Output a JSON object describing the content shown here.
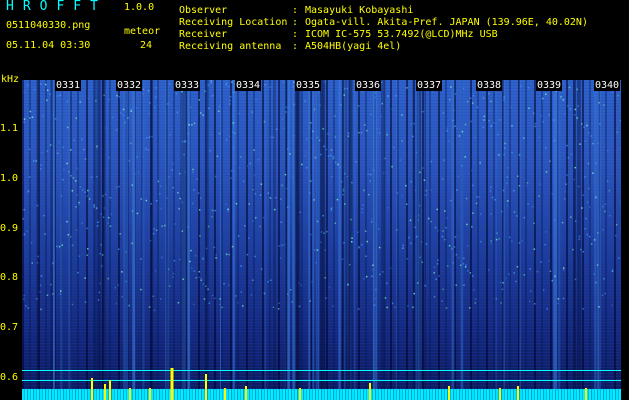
{
  "header": {
    "app_title": "HROFFT",
    "app_version": "1.0.0",
    "file_name": "0511040330.png",
    "meteor_label": "meteor",
    "datetime": "05.11.04 03:30",
    "meteor_count": "24"
  },
  "info": [
    {
      "label": "Observer",
      "value": "Masayuki Kobayashi"
    },
    {
      "label": "Receiving Location",
      "value": "Ogata-vill. Akita-Pref. JAPAN (139.96E, 40.02N)"
    },
    {
      "label": "Receiver",
      "value": "ICOM IC-575 53.7492(@LCD)MHz USB"
    },
    {
      "label": "Receiving antenna",
      "value": "A504HB(yagi 4el)"
    }
  ],
  "colon": ":",
  "y_axis": {
    "unit": "kHz",
    "ticks": [
      "1.1",
      "1.0",
      "0.9",
      "0.8",
      "0.7",
      "0.6"
    ]
  },
  "time_labels": [
    "0331",
    "0332",
    "0333",
    "0334",
    "0335",
    "0336",
    "0337",
    "0338",
    "0339",
    "0340"
  ],
  "colors": {
    "header_text": "#ffff00",
    "title": "#00ffff",
    "reference_line": "#00ffff",
    "meteor_echo": "#ffff00"
  }
}
